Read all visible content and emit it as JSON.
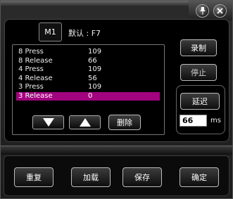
{
  "window": {
    "pin_icon": "pin-icon",
    "close_icon": "close-icon"
  },
  "macro": {
    "slot_label": "M1",
    "default_label": "默认 : F7"
  },
  "events": [
    {
      "name": "8 Press",
      "value": "109"
    },
    {
      "name": "8 Release",
      "value": "66"
    },
    {
      "name": "4 Press",
      "value": "109"
    },
    {
      "name": "4 Release",
      "value": "56"
    },
    {
      "name": "3 Press",
      "value": "109"
    },
    {
      "name": "3 Release",
      "value": "0"
    }
  ],
  "selected_index": 5,
  "list_controls": {
    "down_icon": "arrow-down-icon",
    "up_icon": "arrow-up-icon",
    "delete_label": "删除"
  },
  "side": {
    "record_label": "录制",
    "stop_label": "停止",
    "delay_label": "延迟",
    "delay_value": "66",
    "delay_unit": "ms"
  },
  "footer": {
    "repeat_label": "重复",
    "load_label": "加载",
    "save_label": "保存",
    "ok_label": "确定"
  },
  "colors": {
    "selection": "#a1047e"
  }
}
